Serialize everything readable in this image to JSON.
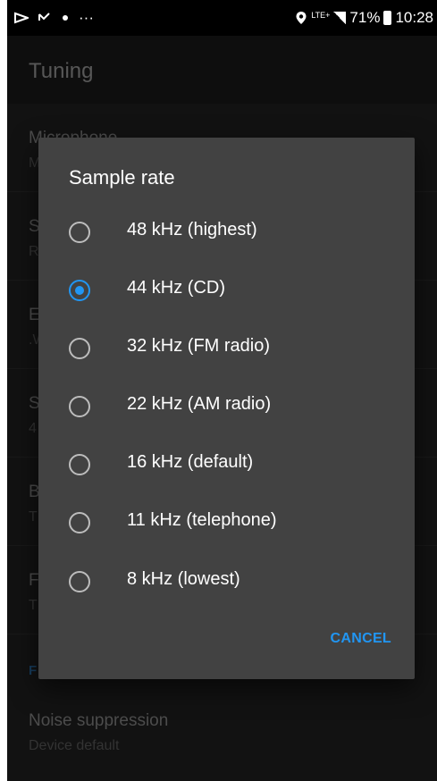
{
  "status_bar": {
    "left_icons": [
      "signal-strength-icon",
      "missed-call-icon",
      "dot-icon"
    ],
    "more": "···",
    "network": "LTE+",
    "battery": "71%",
    "time": "10:28"
  },
  "app_bar": {
    "title": "Tuning"
  },
  "background_prefs": [
    {
      "title": "Microphone",
      "subtitle": "M"
    },
    {
      "title": "S",
      "subtitle": "R"
    },
    {
      "title": "E",
      "subtitle": ".W"
    },
    {
      "title": "S",
      "subtitle": "4"
    },
    {
      "title": "B",
      "subtitle": "T"
    },
    {
      "title": "F",
      "subtitle": "T"
    }
  ],
  "section_header": "F",
  "noise_pref": {
    "title": "Noise suppression",
    "subtitle": "Device default"
  },
  "dialog": {
    "title": "Sample rate",
    "options": [
      {
        "label": "48 kHz (highest)",
        "checked": false
      },
      {
        "label": "44 kHz (CD)",
        "checked": true
      },
      {
        "label": "32 kHz (FM radio)",
        "checked": false
      },
      {
        "label": "22 kHz (AM radio)",
        "checked": false
      },
      {
        "label": "16 kHz (default)",
        "checked": false
      },
      {
        "label": "11 kHz (telephone)",
        "checked": false
      },
      {
        "label": "8 kHz (lowest)",
        "checked": false
      }
    ],
    "cancel_label": "CANCEL"
  },
  "colors": {
    "accent": "#2196f3",
    "dialog_bg": "#424242",
    "screen_bg": "#212121"
  }
}
